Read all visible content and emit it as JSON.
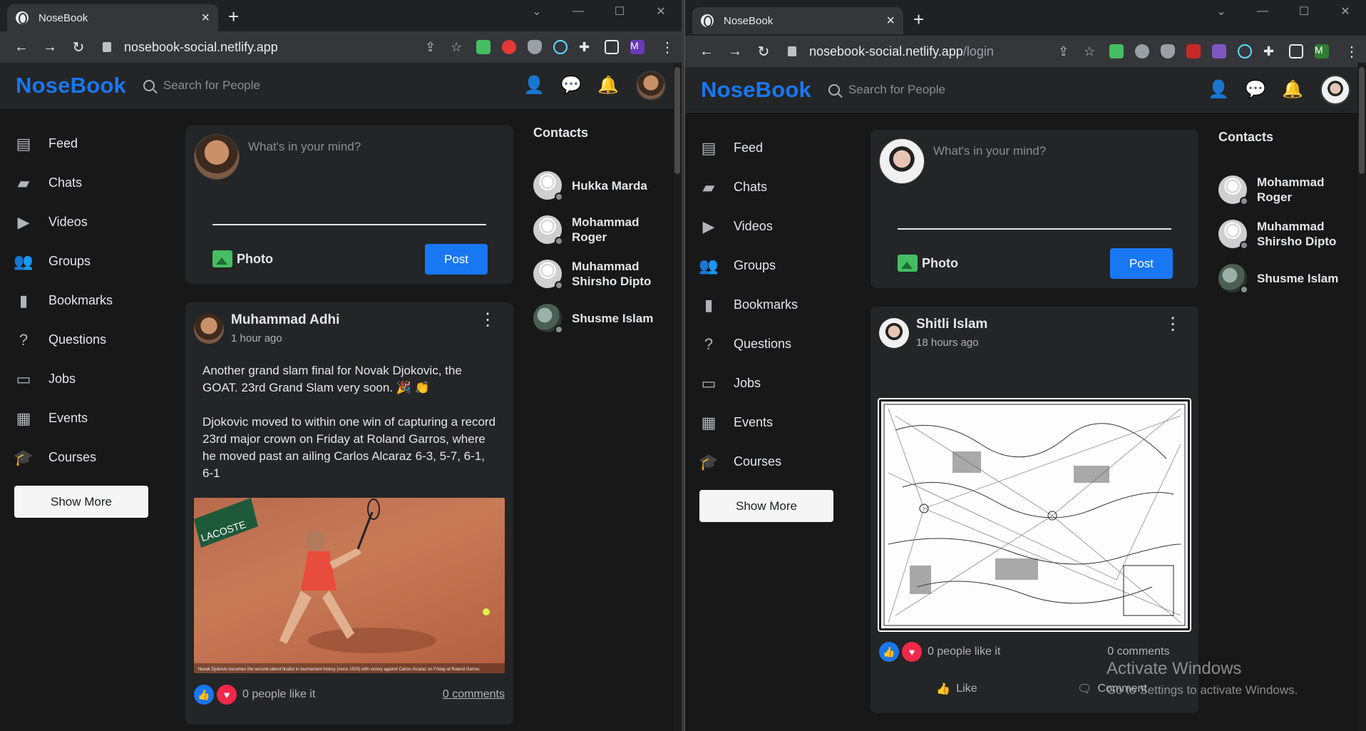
{
  "left": {
    "tab_title": "NoseBook",
    "url_host": "nosebook-social.netlify.app",
    "url_path": "",
    "profile_initial": "M",
    "profile_color": "#673ab7",
    "composer_placeholder": "What's in your mind?",
    "photo_label": "Photo",
    "post_label": "Post",
    "post": {
      "author": "Muhammad Adhi",
      "time": "1 hour ago",
      "text": "Another grand slam final for Novak Djokovic, the GOAT. 23rd Grand Slam very soon. 🎉 👏\n\nDjokovic moved to within one win of capturing a record 23rd major crown on Friday at Roland Garros, where he moved past an ailing Carlos Alcaraz 6-3, 5-7, 6-1, 6-1",
      "image_caption": "Novak Djokovic becomes the second-oldest finalist in tournament history (since 1925) with victory against Carlos Alcaraz on Friday at Roland Garros.",
      "image_brand": "LACOSTE",
      "likes": "0 people like it",
      "comments": "0 comments"
    },
    "contacts": [
      "Hukka Marda",
      "Mohammad Roger",
      "Muhammad Shirsho Dipto",
      "Shusme Islam"
    ]
  },
  "right": {
    "tab_title": "NoseBook",
    "url_host": "nosebook-social.netlify.app",
    "url_path": "/login",
    "profile_initial": "M",
    "profile_color": "#2e7d32",
    "composer_placeholder": "What's in your mind?",
    "photo_label": "Photo",
    "post_label": "Post",
    "post": {
      "author": "Shitli Islam",
      "time": "18 hours ago",
      "likes": "0 people like it",
      "comments": "0 comments",
      "like_action": "Like",
      "comment_action": "Comment"
    },
    "contacts": [
      "Mohammad Roger",
      "Muhammad Shirsho Dipto",
      "Shusme Islam"
    ]
  },
  "app": {
    "logo": "NoseBook",
    "search_placeholder": "Search for People",
    "contacts_title": "Contacts",
    "show_more": "Show More",
    "sidebar": [
      {
        "label": "Feed",
        "icon": "feed-icon"
      },
      {
        "label": "Chats",
        "icon": "chat-icon"
      },
      {
        "label": "Videos",
        "icon": "play-icon"
      },
      {
        "label": "Groups",
        "icon": "group-icon"
      },
      {
        "label": "Bookmarks",
        "icon": "bookmark-icon"
      },
      {
        "label": "Questions",
        "icon": "question-icon"
      },
      {
        "label": "Jobs",
        "icon": "briefcase-icon"
      },
      {
        "label": "Events",
        "icon": "calendar-icon"
      },
      {
        "label": "Courses",
        "icon": "school-icon"
      }
    ]
  },
  "os": {
    "activate_title": "Activate Windows",
    "activate_sub": "Go to Settings to activate Windows."
  },
  "colors": {
    "brand": "#1877f2",
    "bg": "#181818",
    "card": "#242526"
  }
}
